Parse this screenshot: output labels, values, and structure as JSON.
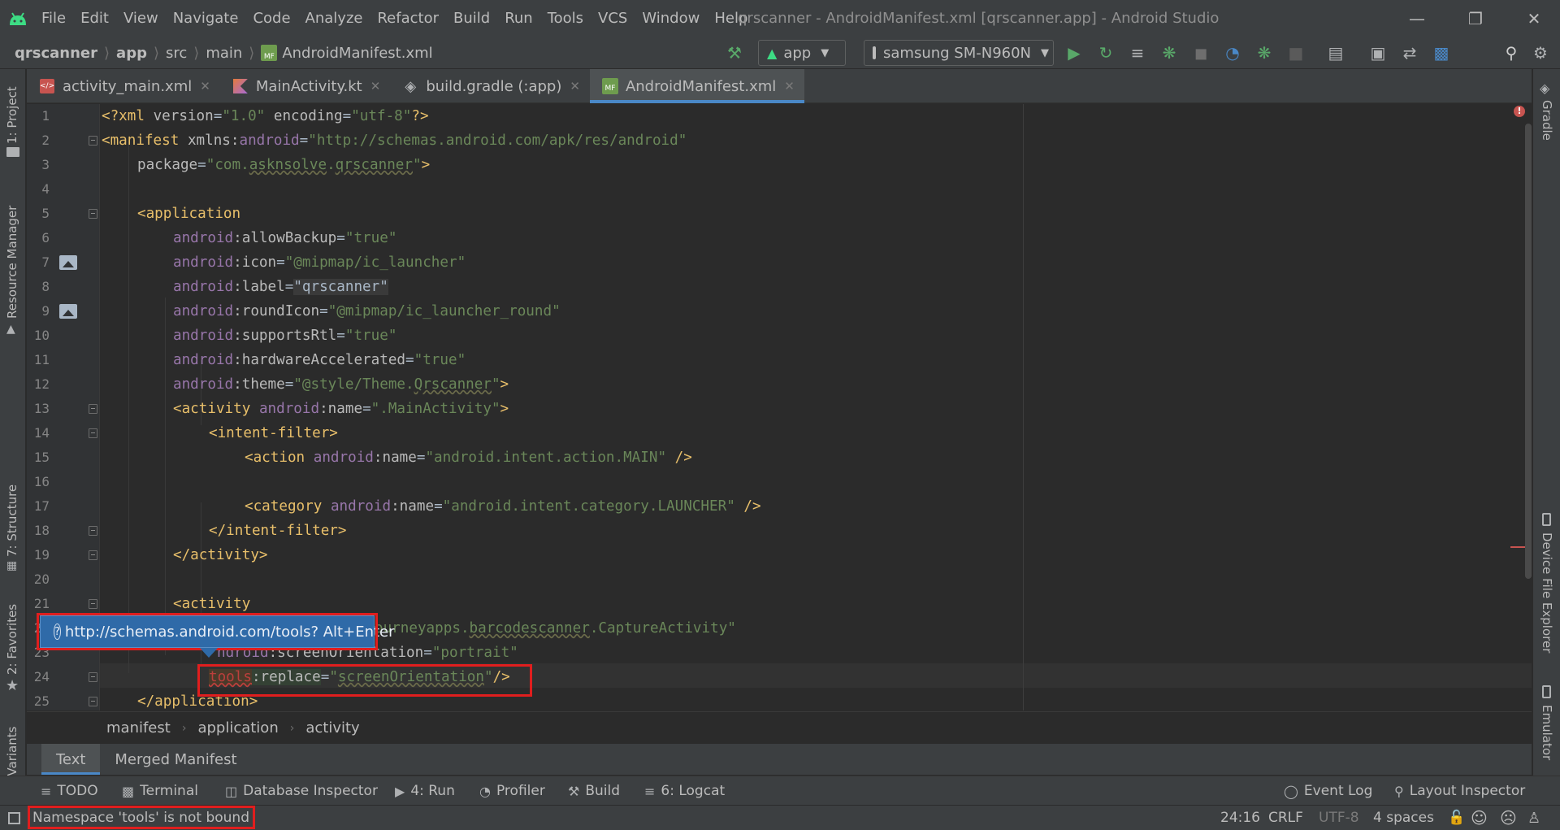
{
  "menu": {
    "items": [
      "File",
      "Edit",
      "View",
      "Navigate",
      "Code",
      "Analyze",
      "Refactor",
      "Build",
      "Run",
      "Tools",
      "VCS",
      "Window",
      "Help"
    ],
    "window_title": "qrscanner - AndroidManifest.xml [qrscanner.app] - Android Studio"
  },
  "breadcrumbs": [
    "qrscanner",
    "app",
    "src",
    "main",
    "AndroidManifest.xml"
  ],
  "toolbar": {
    "run_config": "app",
    "device": "samsung SM-N960N"
  },
  "tabs": [
    {
      "label": "activity_main.xml",
      "icon": "xml-file-icon"
    },
    {
      "label": "MainActivity.kt",
      "icon": "kotlin-file-icon"
    },
    {
      "label": "build.gradle (:app)",
      "icon": "gradle-file-icon"
    },
    {
      "label": "AndroidManifest.xml",
      "icon": "manifest-file-icon",
      "active": true
    }
  ],
  "code": {
    "line_numbers": [
      "1",
      "2",
      "3",
      "4",
      "5",
      "6",
      "7",
      "8",
      "9",
      "10",
      "11",
      "12",
      "13",
      "14",
      "15",
      "16",
      "17",
      "18",
      "19",
      "20",
      "21",
      "22",
      "23",
      "24",
      "25"
    ],
    "l1": {
      "a": "<?xml ",
      "b": "version",
      "c": "=",
      "d": "\"1.0\"",
      "e": " encoding",
      "f": "=",
      "g": "\"utf-8\"",
      "h": "?>"
    },
    "l2": {
      "a": "<manifest ",
      "b": "xmlns:",
      "c": "android",
      "d": "=",
      "e": "\"http://schemas.android.com/apk/res/android\""
    },
    "l3": {
      "a": "package",
      "b": "=",
      "c": "\"com.",
      "d": "asknsolve",
      "e": ".",
      "f": "qrscanner",
      "g": "\"",
      "h": ">"
    },
    "l5": {
      "a": "<application"
    },
    "l6": {
      "ns": "android",
      "attr": ":allowBackup",
      "eq": "=",
      "val": "\"true\""
    },
    "l7": {
      "ns": "android",
      "attr": ":icon",
      "eq": "=",
      "val": "\"@mipmap/ic_launcher\""
    },
    "l8": {
      "ns": "android",
      "attr": ":label",
      "eq": "=",
      "val": "\"qrscanner\""
    },
    "l9": {
      "ns": "android",
      "attr": ":roundIcon",
      "eq": "=",
      "val": "\"@mipmap/ic_launcher_round\""
    },
    "l10": {
      "ns": "android",
      "attr": ":supportsRtl",
      "eq": "=",
      "val": "\"true\""
    },
    "l11": {
      "ns": "android",
      "attr": ":hardwareAccelerated",
      "eq": "=",
      "val": "\"true\""
    },
    "l12": {
      "ns": "android",
      "attr": ":theme",
      "eq": "=",
      "val1": "\"@style/Theme.",
      "val2": "Qrscanner",
      "val3": "\"",
      "close": ">"
    },
    "l13": {
      "tag": "<activity ",
      "ns": "android",
      "attr": ":name",
      "eq": "=",
      "val": "\".MainActivity\"",
      "close": ">"
    },
    "l14": {
      "tag": "<intent-filter>"
    },
    "l15": {
      "tag": "<action ",
      "ns": "android",
      "attr": ":name",
      "eq": "=",
      "val": "\"android.intent.action.MAIN\"",
      "close": " />"
    },
    "l17": {
      "tag": "<category ",
      "ns": "android",
      "attr": ":name",
      "eq": "=",
      "val": "\"android.intent.category.LAUNCHER\"",
      "close": " />"
    },
    "l18": {
      "tag": "</intent-filter>"
    },
    "l19": {
      "tag": "</activity>"
    },
    "l21": {
      "tag": "<activity"
    },
    "l22": {
      "a": "ourneyapps",
      "b": ".",
      "c": "barcodescanner",
      "d": ".CaptureActivity\""
    },
    "l23": {
      "a": "ndroid",
      "b": ":screenOrientation",
      "c": "=",
      "d": "\"portrait\""
    },
    "l24": {
      "ns": "tools",
      "attr": ":replace",
      "eq": "=",
      "val1": "\"",
      "val2": "screenOrientation",
      "val3": "\"",
      "close": "/>"
    },
    "l25": {
      "tag": "</application>"
    }
  },
  "tooltip": {
    "text": "http://schemas.android.com/tools? Alt+Enter",
    "icon": "help-icon"
  },
  "editor_breadcrumb": [
    "manifest",
    "application",
    "activity"
  ],
  "manifest_tabs": [
    {
      "label": "Text",
      "active": true
    },
    {
      "label": "Merged Manifest"
    }
  ],
  "bottom_tools": [
    "TODO",
    "Terminal",
    "Database Inspector",
    "4: Run",
    "Profiler",
    "Build",
    "6: Logcat",
    "Event Log",
    "Layout Inspector"
  ],
  "left_tools": [
    "1: Project",
    "Resource Manager",
    "7: Structure",
    "2: Favorites",
    "Build Variants"
  ],
  "right_tools": [
    "Gradle",
    "Device File Explorer",
    "Emulator"
  ],
  "status": {
    "message": "Namespace 'tools' is not bound",
    "position": "24:16",
    "line_sep": "CRLF",
    "encoding": "UTF-8",
    "indent": "4 spaces"
  },
  "colors": {
    "accent": "#4a88c7",
    "error": "#e01e1e",
    "tag": "#e8bf6a",
    "string": "#6a8759",
    "namespace": "#9876aa"
  }
}
